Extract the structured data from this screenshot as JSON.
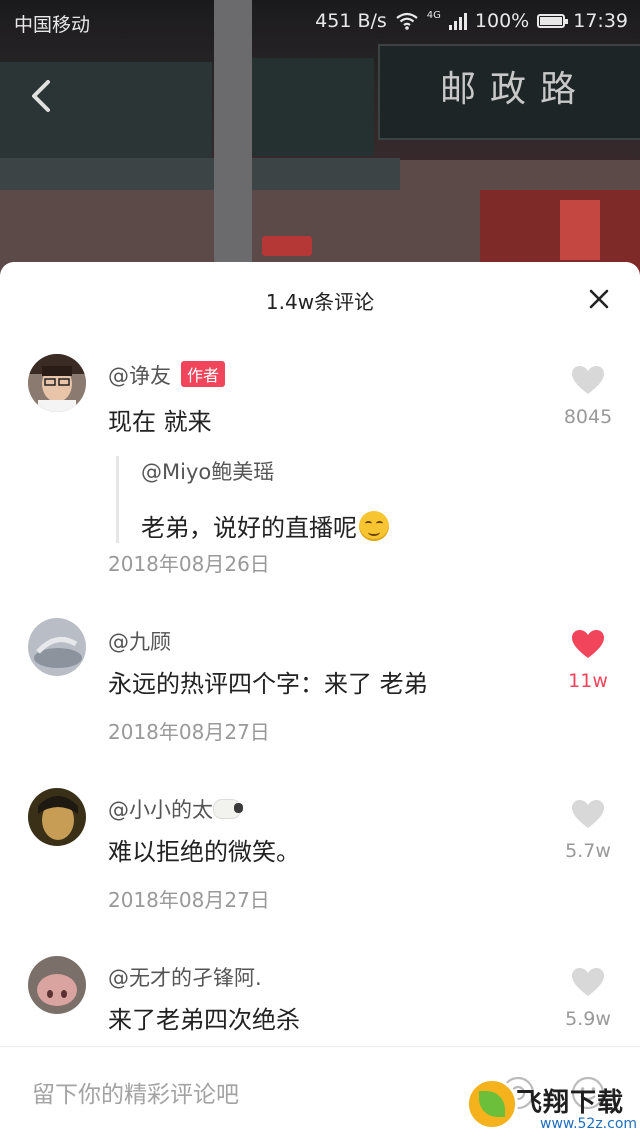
{
  "status_bar": {
    "carrier": "中国移动",
    "speed": "451 B/s",
    "network": "4G",
    "battery": "100%",
    "time": "17:39"
  },
  "background": {
    "sign_text": "邮政路"
  },
  "sheet": {
    "title": "1.4w条评论"
  },
  "comments": [
    {
      "username": "@诤友",
      "badge": "作者",
      "text": "现在 就来",
      "likes": "8045",
      "liked": false,
      "reply": {
        "username": "@Miyo鲍美瑶",
        "text": "老弟，说好的直播呢",
        "emoji": "smirk-emoji"
      },
      "date": "2018年08月26日"
    },
    {
      "username": "@九顾",
      "text": "永远的热评四个字：来了 老弟",
      "likes": "11w",
      "liked": true,
      "date": "2018年08月27日"
    },
    {
      "username": "@小小的太",
      "username_emoji": "sheep-emoji",
      "text": "难以拒绝的微笑。",
      "likes": "5.7w",
      "liked": false,
      "date": "2018年08月27日"
    },
    {
      "username": "@无才的孑锋阿.",
      "text": "来了老弟四次绝杀",
      "likes": "5.9w",
      "liked": false
    }
  ],
  "input_bar": {
    "placeholder": "留下你的精彩评论吧"
  },
  "watermark": {
    "name": "飞翔下载",
    "site": "www.52z.com"
  },
  "colors": {
    "accent": "#f0455b",
    "text_primary": "#222222",
    "text_secondary": "#999999"
  }
}
